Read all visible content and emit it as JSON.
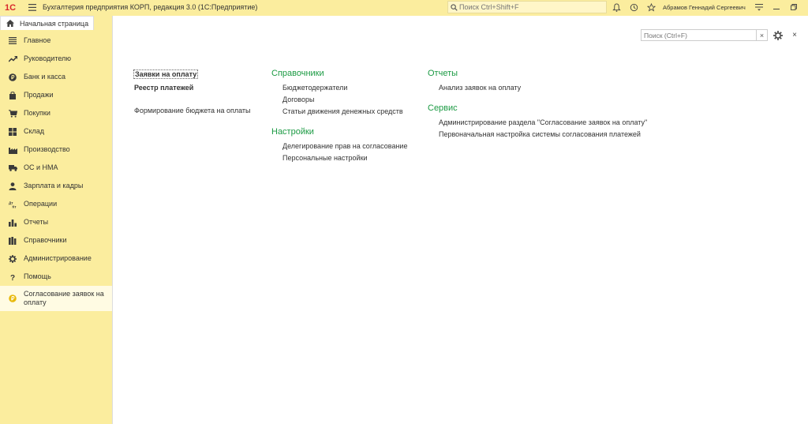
{
  "titlebar": {
    "logo_text": "1С",
    "app_title": "Бухгалтерия предприятия КОРП, редакция 3.0  (1С:Предприятие)",
    "search_placeholder": "Поиск Ctrl+Shift+F",
    "user_name": "Абрамов Геннадий Сергеевич"
  },
  "home_tab": {
    "label": "Начальная страница"
  },
  "sidebar": {
    "items": [
      {
        "label": "Главное",
        "icon": "list-icon"
      },
      {
        "label": "Руководителю",
        "icon": "trend-icon"
      },
      {
        "label": "Банк и касса",
        "icon": "coin-icon"
      },
      {
        "label": "Продажи",
        "icon": "bag-icon"
      },
      {
        "label": "Покупки",
        "icon": "cart-icon"
      },
      {
        "label": "Склад",
        "icon": "warehouse-icon"
      },
      {
        "label": "Производство",
        "icon": "factory-icon"
      },
      {
        "label": "ОС и НМА",
        "icon": "truck-icon"
      },
      {
        "label": "Зарплата и кадры",
        "icon": "person-icon"
      },
      {
        "label": "Операции",
        "icon": "dt-kt-icon"
      },
      {
        "label": "Отчеты",
        "icon": "bar-chart-icon"
      },
      {
        "label": "Справочники",
        "icon": "books-icon"
      },
      {
        "label": "Администрирование",
        "icon": "gear-icon"
      },
      {
        "label": "Помощь",
        "icon": "question-icon"
      }
    ],
    "active_item": {
      "label": "Согласование заявок на оплату",
      "icon": "approval-icon"
    }
  },
  "main": {
    "search_placeholder": "Поиск (Ctrl+F)",
    "clear_label": "×",
    "close_label": "×",
    "col1": {
      "links": [
        "Заявки на оплату",
        "Реестр платежей",
        "Формирование бюджета на оплаты"
      ]
    },
    "col2": {
      "sections": [
        {
          "title": "Справочники",
          "links": [
            "Бюджетодержатели",
            "Договоры",
            "Статьи движения денежных средств"
          ]
        },
        {
          "title": "Настройки",
          "links": [
            "Делегирование прав на согласование",
            "Персональные настройки"
          ]
        }
      ]
    },
    "col3": {
      "sections": [
        {
          "title": "Отчеты",
          "links": [
            "Анализ заявок на оплату"
          ]
        },
        {
          "title": "Сервис",
          "links": [
            "Администрирование раздела \"Согласование заявок на оплату\"",
            "Первоначальная настройка системы согласования платежей"
          ]
        }
      ]
    }
  },
  "colors": {
    "sidebar_bg": "#fbed9e",
    "active_bg": "#fffbe3",
    "section_green": "#1b9a43",
    "logo_red": "#d8262b"
  }
}
